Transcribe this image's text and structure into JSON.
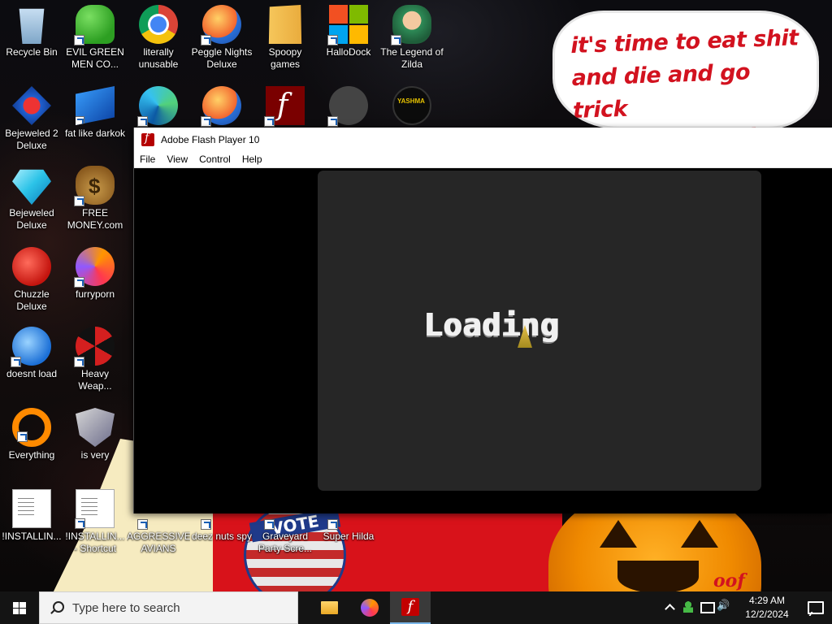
{
  "desktop": {
    "icons": [
      {
        "label": "Recycle Bin",
        "icon": "recycle-bin-icon"
      },
      {
        "label": "EVIL GREEN MEN CO...",
        "icon": "green-men-icon"
      },
      {
        "label": "literally unusable",
        "icon": "chrome-icon"
      },
      {
        "label": "Peggle Nights Deluxe",
        "icon": "peggle-icon"
      },
      {
        "label": "Spoopy games",
        "icon": "folder-icon"
      },
      {
        "label": "HalloDock",
        "icon": "windows-shield-icon"
      },
      {
        "label": "The Legend of Zilda",
        "icon": "zilda-icon"
      },
      {
        "label": "Bejeweled 2 Deluxe",
        "icon": "bejeweled2-icon"
      },
      {
        "label": "fat like darkok",
        "icon": "mpl-icon"
      },
      {
        "label": "Bejeweled Deluxe",
        "icon": "gem-icon"
      },
      {
        "label": "FREE MONEY.com",
        "icon": "money-bag-icon"
      },
      {
        "label": "Chuzzle Deluxe",
        "icon": "chuzzle-icon"
      },
      {
        "label": "furryporn",
        "icon": "firefox-icon"
      },
      {
        "label": "doesnt load",
        "icon": "thunderbird-icon"
      },
      {
        "label": "Heavy Weap...",
        "icon": "radiation-icon"
      },
      {
        "label": "Everything",
        "icon": "everything-icon"
      },
      {
        "label": "is very",
        "icon": "shield-logo-icon"
      },
      {
        "label": "!INSTALLIN...",
        "icon": "document-icon"
      },
      {
        "label": "!INSTALLIN... - Shortcut",
        "icon": "document-icon"
      },
      {
        "label": "AGGRESSIVE AVIANS",
        "icon": "game-icon"
      },
      {
        "label": "deez nuts spy",
        "icon": "game-icon"
      },
      {
        "label": "Graveyard Party Scre...",
        "icon": "game-icon"
      },
      {
        "label": "Super Hilda",
        "icon": "game-icon"
      }
    ],
    "wallpaper": {
      "speech_bubble_lines": "it's time to eat shit\nand die and go trick\nor treating and vote!",
      "vote_sign": "VOTE",
      "corner_text": "oof"
    }
  },
  "window": {
    "title": "Adobe Flash Player 10",
    "menu": [
      "File",
      "View",
      "Control",
      "Help"
    ],
    "stage": {
      "status_text": "Loading",
      "background_color": "#262626"
    }
  },
  "taskbar": {
    "search_placeholder": "Type here to search",
    "pinned_apps": [
      "file-explorer-icon",
      "firefox-icon",
      "flash-player-icon"
    ],
    "active_app": "flash-player-icon",
    "clock": {
      "time": "4:29 AM",
      "date": "12/2/2024"
    }
  }
}
